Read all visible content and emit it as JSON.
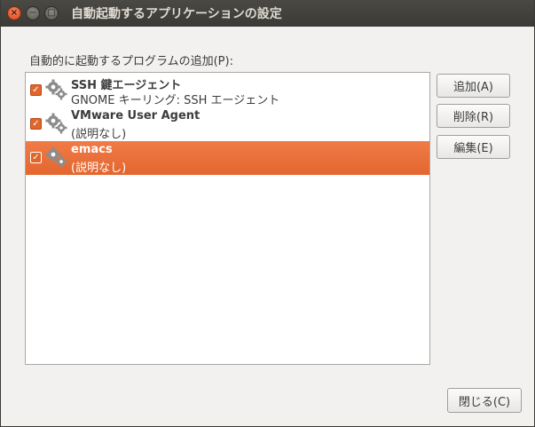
{
  "window": {
    "title": "自動起動するアプリケーションの設定",
    "close_glyph": "×",
    "minimize_glyph": "−",
    "maximize_glyph": "□"
  },
  "list": {
    "label": "自動的に起動するプログラムの追加(P):",
    "items": [
      {
        "name": "SSH 鍵エージェント",
        "description": "GNOME キーリング: SSH エージェント",
        "checked": true,
        "selected": false,
        "icon": "gears-icon"
      },
      {
        "name": "VMware User Agent",
        "description": "(説明なし)",
        "checked": true,
        "selected": false,
        "icon": "gears-icon"
      },
      {
        "name": "emacs",
        "description": "(説明なし)",
        "checked": true,
        "selected": true,
        "icon": "gears-icon"
      }
    ]
  },
  "buttons": {
    "add": "追加(A)",
    "remove": "削除(R)",
    "edit": "編集(E)",
    "close": "閉じる(C)"
  },
  "check_glyph": "✓",
  "colors": {
    "accent": "#e3662e",
    "titlebar": "#3b3a36",
    "background": "#f2f1f0"
  }
}
